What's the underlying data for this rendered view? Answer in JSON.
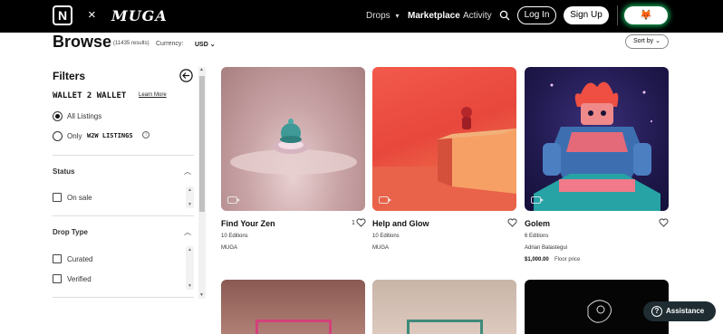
{
  "nav": {
    "logo_letter": "N",
    "cross": "×",
    "brand": "MUGA",
    "drops": "Drops",
    "marketplace": "Marketplace",
    "activity": "Activity",
    "login": "Log In",
    "signup": "Sign Up",
    "wallet_icon": "🦊"
  },
  "browse": {
    "title": "Browse",
    "count": "(11435 results)",
    "currency_label": "Currency:",
    "currency_value": "USD",
    "sort": "Sort by"
  },
  "filters": {
    "title": "Filters",
    "w2w_brand": "WALLET 2 WALLET",
    "learn_more": "Learn More",
    "all_listings": "All Listings",
    "only": "Only",
    "w2w_small": "W2W LISTINGS",
    "info": "i",
    "status": {
      "title": "Status",
      "options": [
        "On sale"
      ]
    },
    "drop_type": {
      "title": "Drop Type",
      "options": [
        "Curated",
        "Verified"
      ]
    }
  },
  "cards": [
    {
      "title": "Find Your Zen",
      "editions": "10 Editions",
      "artist": "MUGA",
      "likes": "1"
    },
    {
      "title": "Help and Glow",
      "editions": "10 Editions",
      "artist": "MUGA"
    },
    {
      "title": "Golem",
      "editions": "6 Editions",
      "artist": "Adrian Balastegui",
      "price": "$1,000.00",
      "price_note": "Floor price"
    }
  ],
  "assistance": "Assistance",
  "colors": {
    "nav_bg": "#000000",
    "wallet_glow": "#11aa55",
    "assist_bg": "#1f2d33"
  }
}
